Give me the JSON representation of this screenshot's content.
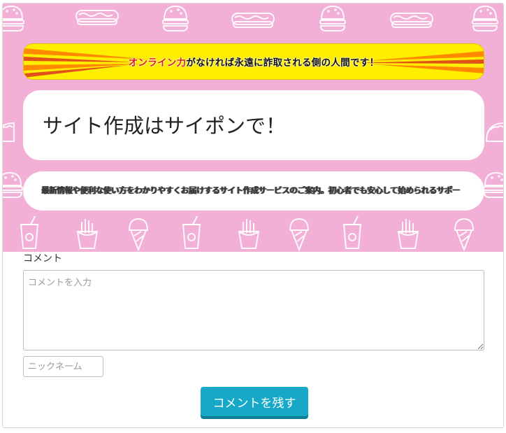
{
  "banner": {
    "highlight": "オンライン力",
    "text": "がなければ永遠に詐取される側の人間です！"
  },
  "title": "サイト作成はサイポンで！",
  "description": "最新情報や便利な使い方をわかりやすくお届けするサイト作成サービスのご案内。初心者でも安心して始められるサポート体制を整えています。",
  "comment": {
    "label": "コメント",
    "placeholder": "コメントを入力",
    "nickname_placeholder": "ニックネーム",
    "submit_label": "コメントを残す"
  },
  "icons": [
    "burger-icon",
    "hotdog-icon",
    "taco-icon",
    "drink-icon",
    "fries-icon",
    "ice-cream-icon"
  ],
  "colors": {
    "background_pink": "#f3b0d7",
    "banner_yellow": "#ffee00",
    "highlight_red": "#e01919",
    "button_teal": "#17a8c8"
  }
}
